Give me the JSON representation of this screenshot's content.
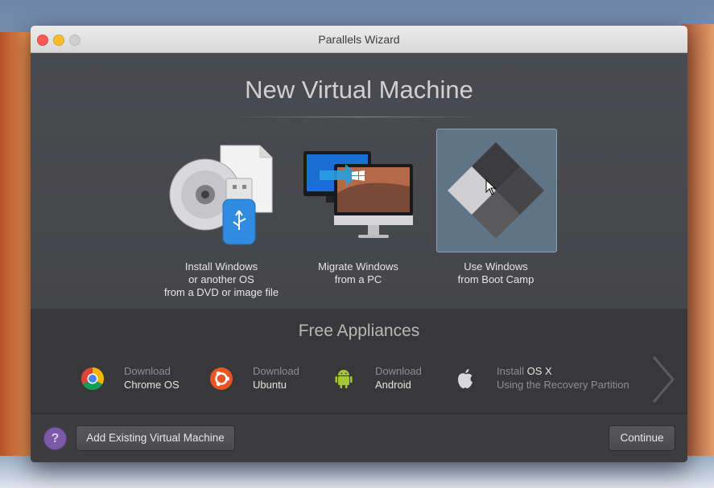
{
  "window": {
    "title": "Parallels Wizard"
  },
  "main": {
    "heading": "New Virtual Machine",
    "options": [
      {
        "line1": "Install Windows",
        "line2": "or another OS",
        "line3": "from a DVD or image file",
        "icon": "dvd-usb-icon"
      },
      {
        "line1": "Migrate Windows",
        "line2": "from a PC",
        "icon": "migrate-pc-icon"
      },
      {
        "line1": "Use Windows",
        "line2": "from Boot Camp",
        "icon": "boot-camp-icon",
        "selected": true
      }
    ]
  },
  "appliances": {
    "heading": "Free Appliances",
    "items": [
      {
        "line1": "Download",
        "line2": "Chrome OS",
        "icon": "chrome-icon"
      },
      {
        "line1": "Download",
        "line2": "Ubuntu",
        "icon": "ubuntu-icon"
      },
      {
        "line1": "Download",
        "line2": "Android",
        "icon": "android-icon"
      },
      {
        "line1_prefix": "Install",
        "line1_highlight": "OS X",
        "line2": "Using the Recovery Partition",
        "icon": "apple-icon"
      }
    ]
  },
  "footer": {
    "help": "?",
    "add_existing": "Add Existing Virtual Machine",
    "continue": "Continue"
  }
}
